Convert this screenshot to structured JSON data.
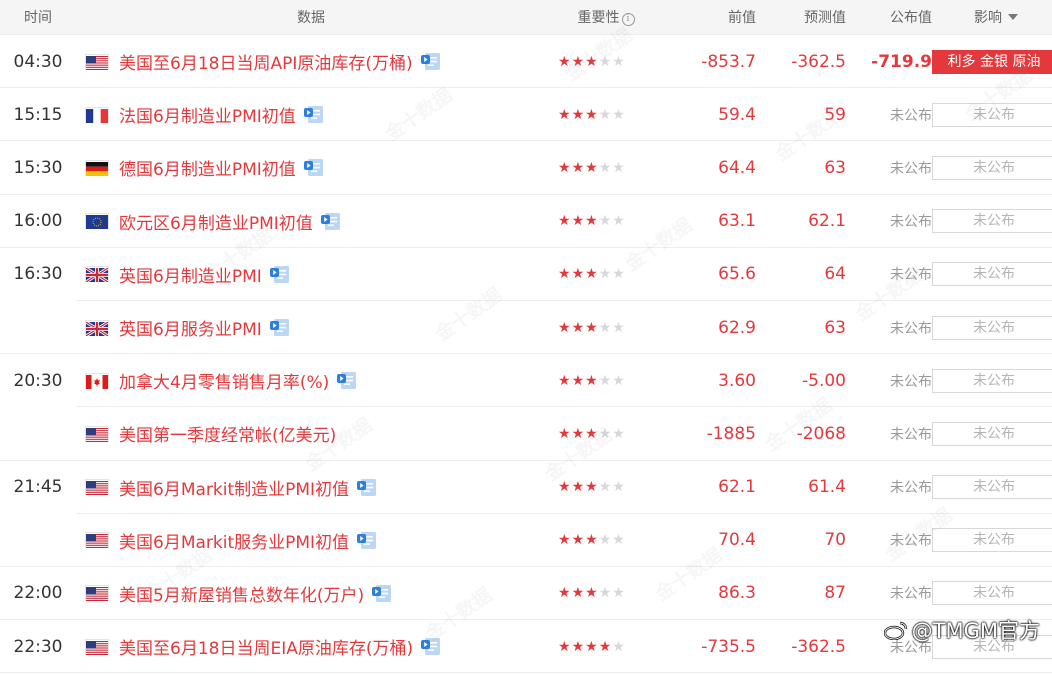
{
  "header": {
    "time": "时间",
    "data": "数据",
    "importance": "重要性",
    "previous": "前值",
    "forecast": "预测值",
    "actual": "公布值",
    "effect": "影响"
  },
  "watermark_text": "金十数据",
  "brand_text": "@TMGM官方",
  "rows": [
    {
      "time": "04:30",
      "flag": "us",
      "title": "美国至6月18日当周API原油库存(万桶)",
      "stars": 3,
      "prev": "-853.7",
      "forecast": "-362.5",
      "actual": "-719.9",
      "effect": "利多 金银 原油",
      "effect_type": "bull"
    },
    {
      "time": "15:15",
      "flag": "fr",
      "title": "法国6月制造业PMI初值",
      "stars": 3,
      "prev": "59.4",
      "forecast": "59",
      "actual": "未公布",
      "effect": "未公布",
      "effect_type": "pending"
    },
    {
      "time": "15:30",
      "flag": "de",
      "title": "德国6月制造业PMI初值",
      "stars": 3,
      "prev": "64.4",
      "forecast": "63",
      "actual": "未公布",
      "effect": "未公布",
      "effect_type": "pending"
    },
    {
      "time": "16:00",
      "flag": "eu",
      "title": "欧元区6月制造业PMI初值",
      "stars": 3,
      "prev": "63.1",
      "forecast": "62.1",
      "actual": "未公布",
      "effect": "未公布",
      "effect_type": "pending"
    },
    {
      "time": "16:30",
      "flag": "uk",
      "title": "英国6月制造业PMI",
      "stars": 3,
      "prev": "65.6",
      "forecast": "64",
      "actual": "未公布",
      "effect": "未公布",
      "effect_type": "pending"
    },
    {
      "time": "",
      "flag": "uk",
      "title": "英国6月服务业PMI",
      "stars": 3,
      "prev": "62.9",
      "forecast": "63",
      "actual": "未公布",
      "effect": "未公布",
      "effect_type": "pending"
    },
    {
      "time": "20:30",
      "flag": "ca",
      "title": "加拿大4月零售销售月率(%)",
      "stars": 3,
      "prev": "3.60",
      "forecast": "-5.00",
      "actual": "未公布",
      "effect": "未公布",
      "effect_type": "pending"
    },
    {
      "time": "",
      "flag": "us",
      "title": "美国第一季度经常帐(亿美元)",
      "stars": 3,
      "prev": "-1885",
      "forecast": "-2068",
      "actual": "未公布",
      "effect": "未公布",
      "effect_type": "pending",
      "no_icon": true
    },
    {
      "time": "21:45",
      "flag": "us",
      "title": "美国6月Markit制造业PMI初值",
      "stars": 3,
      "prev": "62.1",
      "forecast": "61.4",
      "actual": "未公布",
      "effect": "未公布",
      "effect_type": "pending"
    },
    {
      "time": "",
      "flag": "us",
      "title": "美国6月Markit服务业PMI初值",
      "stars": 3,
      "prev": "70.4",
      "forecast": "70",
      "actual": "未公布",
      "effect": "未公布",
      "effect_type": "pending"
    },
    {
      "time": "22:00",
      "flag": "us",
      "title": "美国5月新屋销售总数年化(万户)",
      "stars": 3,
      "prev": "86.3",
      "forecast": "87",
      "actual": "未公布",
      "effect": "未公布",
      "effect_type": "pending"
    },
    {
      "time": "22:30",
      "flag": "us",
      "title": "美国至6月18日当周EIA原油库存(万桶)",
      "stars": 4,
      "prev": "-735.5",
      "forecast": "-362.5",
      "actual": "未公布",
      "effect": "未公布",
      "effect_type": "pending"
    }
  ]
}
